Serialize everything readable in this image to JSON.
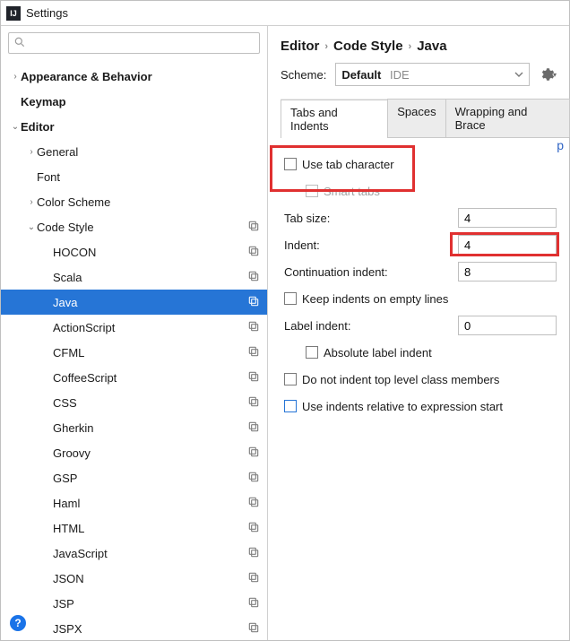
{
  "window": {
    "title": "Settings"
  },
  "sidebar": {
    "search_placeholder": "",
    "items": [
      {
        "label": "Appearance & Behavior",
        "chev": ">",
        "bold": true,
        "pad": 0
      },
      {
        "label": "Keymap",
        "chev": "",
        "bold": true,
        "pad": 0
      },
      {
        "label": "Editor",
        "chev": "v",
        "bold": true,
        "pad": 0
      },
      {
        "label": "General",
        "chev": ">",
        "pad": 1
      },
      {
        "label": "Font",
        "chev": "",
        "pad": 1
      },
      {
        "label": "Color Scheme",
        "chev": ">",
        "pad": 1
      },
      {
        "label": "Code Style",
        "chev": "v",
        "pad": 1,
        "copy": true
      },
      {
        "label": "HOCON",
        "pad": 2,
        "copy": true
      },
      {
        "label": "Scala",
        "pad": 2,
        "copy": true
      },
      {
        "label": "Java",
        "pad": 2,
        "copy": true,
        "selected": true
      },
      {
        "label": "ActionScript",
        "pad": 2,
        "copy": true
      },
      {
        "label": "CFML",
        "pad": 2,
        "copy": true
      },
      {
        "label": "CoffeeScript",
        "pad": 2,
        "copy": true
      },
      {
        "label": "CSS",
        "pad": 2,
        "copy": true
      },
      {
        "label": "Gherkin",
        "pad": 2,
        "copy": true
      },
      {
        "label": "Groovy",
        "pad": 2,
        "copy": true
      },
      {
        "label": "GSP",
        "pad": 2,
        "copy": true
      },
      {
        "label": "Haml",
        "pad": 2,
        "copy": true
      },
      {
        "label": "HTML",
        "pad": 2,
        "copy": true
      },
      {
        "label": "JavaScript",
        "pad": 2,
        "copy": true
      },
      {
        "label": "JSON",
        "pad": 2,
        "copy": true
      },
      {
        "label": "JSP",
        "pad": 2,
        "copy": true
      },
      {
        "label": "JSPX",
        "pad": 2,
        "copy": true
      }
    ]
  },
  "breadcrumb": [
    "Editor",
    "Code Style",
    "Java"
  ],
  "scheme": {
    "label": "Scheme:",
    "value": "Default",
    "suffix": "IDE"
  },
  "tabs": [
    {
      "label": "Tabs and Indents",
      "active": true
    },
    {
      "label": "Spaces"
    },
    {
      "label": "Wrapping and Brace"
    }
  ],
  "settings": {
    "use_tab_character": "Use tab character",
    "smart_tabs": "Smart tabs",
    "tab_size_label": "Tab size:",
    "tab_size_value": "4",
    "indent_label": "Indent:",
    "indent_value": "4",
    "cont_indent_label": "Continuation indent:",
    "cont_indent_value": "8",
    "keep_indents": "Keep indents on empty lines",
    "label_indent_label": "Label indent:",
    "label_indent_value": "0",
    "absolute_label": "Absolute label indent",
    "no_top_level": "Do not indent top level class members",
    "relative_indents": "Use indents relative to expression start"
  },
  "preview_letter": "p",
  "help": "?"
}
